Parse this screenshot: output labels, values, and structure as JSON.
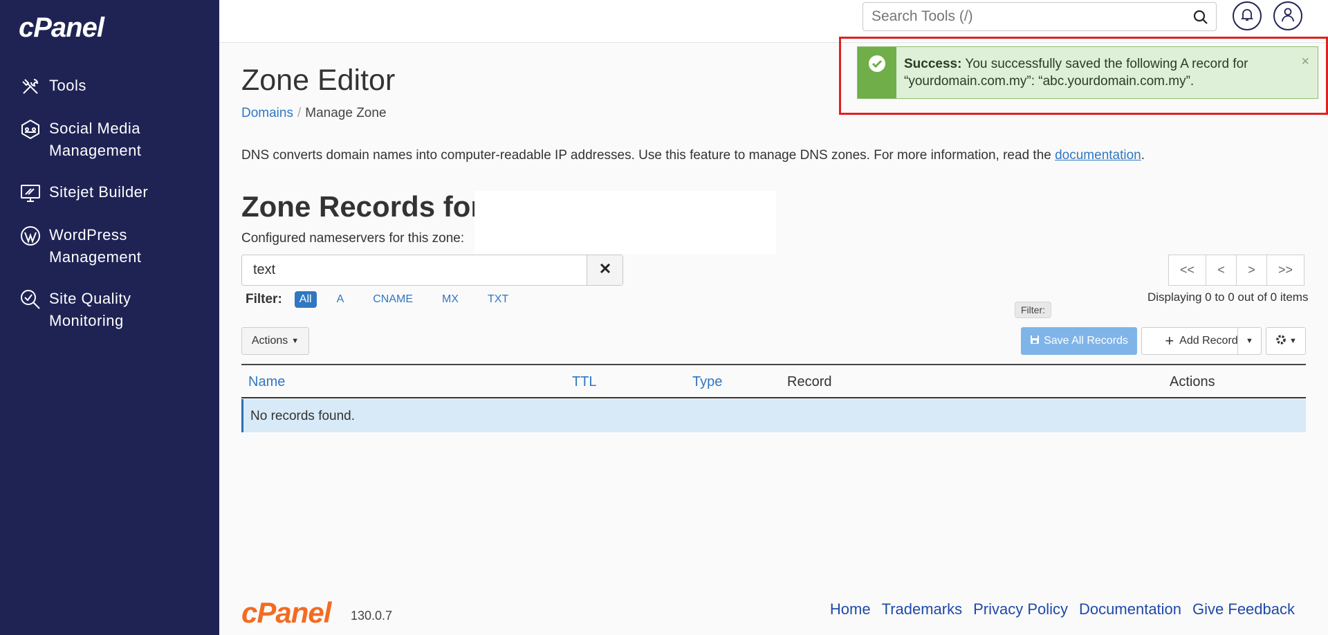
{
  "brand": "cPanel",
  "sidebar": {
    "items": [
      {
        "label": "Tools",
        "icon": "tools-icon"
      },
      {
        "label": "Social Media Management",
        "icon": "social-media-icon"
      },
      {
        "label": "Sitejet Builder",
        "icon": "sitejet-icon"
      },
      {
        "label": "WordPress Management",
        "icon": "wordpress-icon"
      },
      {
        "label": "Site Quality Monitoring",
        "icon": "site-quality-icon"
      }
    ]
  },
  "header": {
    "search_placeholder": "Search Tools (/)"
  },
  "alert": {
    "strong": "Success:",
    "message": " You successfully saved the following A record for “yourdomain.com.my”: “abc.yourdomain.com.my”.",
    "close": "×"
  },
  "page": {
    "title": "Zone Editor",
    "breadcrumb_domains": "Domains",
    "breadcrumb_sep": "/",
    "breadcrumb_current": "Manage Zone",
    "description": "DNS converts domain names into computer-readable IP addresses. Use this feature to manage DNS zones. For more information, read the ",
    "doc_link": "documentation",
    "description_end": "."
  },
  "zone": {
    "heading": "Zone Records for “",
    "nameservers_label": "Configured nameservers for this zone:",
    "filter_value": "text",
    "filter_label": "Filter:",
    "filters": [
      "All",
      "A",
      "CNAME",
      "MX",
      "TXT"
    ],
    "pager": [
      "<<",
      "<",
      ">",
      ">>"
    ],
    "displaying": "Displaying 0 to 0 out of 0 items",
    "tooltip": "Filter:",
    "actions_btn": "Actions",
    "save_all": "Save All Records",
    "add_record": "Add Record"
  },
  "table": {
    "columns": [
      "Name",
      "TTL",
      "Type",
      "Record",
      "Actions"
    ],
    "empty": "No records found."
  },
  "footer": {
    "logo": "cPanel",
    "version": "130.0.7",
    "links": [
      "Home",
      "Trademarks",
      "Privacy Policy",
      "Documentation",
      "Give Feedback"
    ]
  }
}
